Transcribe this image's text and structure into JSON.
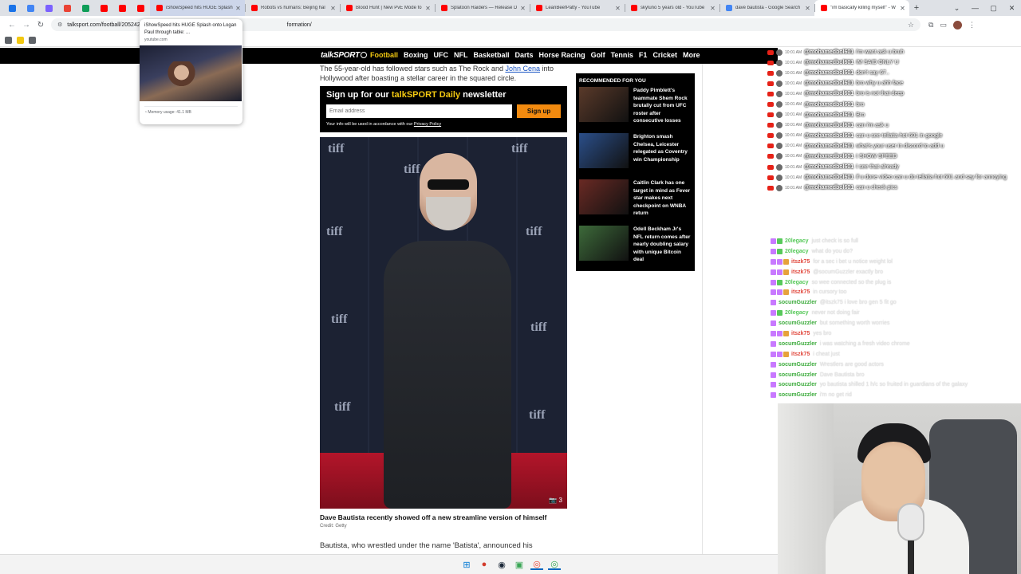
{
  "browser": {
    "pinned_colors": [
      "#1a73e8",
      "#4285f4",
      "#7b61ff",
      "#ea4335",
      "#0f9d58",
      "#ff0000",
      "#ff0000",
      "#ff0000"
    ],
    "tabs": [
      {
        "title": "iShowSpeed hits HUGE Splash",
        "fav": "#ff0000",
        "state": "hover"
      },
      {
        "title": "Robots vs humans: Beijing hal",
        "fav": "#ff0000",
        "state": ""
      },
      {
        "title": "Blood Hunt | New PvE Mode fo",
        "fav": "#ff0000",
        "state": ""
      },
      {
        "title": "Splatoon Raiders — Release D",
        "fav": "#ff0000",
        "state": ""
      },
      {
        "title": "LeanBeefPatty - YouTube",
        "fav": "#ff0000",
        "state": ""
      },
      {
        "title": "skyluno 5 years old - YouTube",
        "fav": "#ff0000",
        "state": ""
      },
      {
        "title": "dave bautista - Google Search",
        "fav": "#4285f4",
        "state": ""
      },
      {
        "title": "\"im basically killing myself\" - W",
        "fav": "#ff0000",
        "state": "active"
      }
    ],
    "new_tab": "+",
    "window_controls": [
      "▢",
      "—",
      "▢",
      "✕"
    ],
    "url_prefix": "talksport.com/football/2052421",
    "url_suffix": "formation/",
    "bookmark_colors": [
      "#5f6368",
      "#f2c811",
      "#5f6368"
    ]
  },
  "hovercard": {
    "title": "iShowSpeed hits HUGE Splash onto Logan Paul through table: ...",
    "site": "youtube.com",
    "memory": "Memory usage: 41.1 MB"
  },
  "site": {
    "logo": "talkSPORT",
    "nav": [
      "Football",
      "Boxing",
      "UFC",
      "NFL",
      "Basketball",
      "Darts",
      "Horse Racing",
      "Golf",
      "Tennis",
      "F1",
      "Cricket",
      "More"
    ],
    "intro_pre": "The 55-year-old has followed stars such as The Rock and ",
    "intro_link": "John Cena",
    "intro_post": "into Hollywood after boasting a stellar career in the squared circle.",
    "newsletter": {
      "head_pre": "Sign up for our ",
      "head_brand": "talkSPORT Daily",
      "head_post": " newsletter",
      "placeholder": "Email address",
      "button": "Sign up",
      "foot_pre": "Your info will be used in accordance with our ",
      "foot_link": "Privacy Policy"
    },
    "photo_count": "3",
    "caption": "Dave Bautista recently showed off a new streamline version of himself",
    "credit": "Credit: Getty",
    "body": "Bautista, who wrestled under the name 'Batista', announced his",
    "recommended_title": "RECOMMENDED FOR YOU",
    "recommended": [
      {
        "text": "Paddy Pimblett's teammate Shem Rock brutally cut from UFC roster after consecutive losses",
        "thumb": "#5a3a2a"
      },
      {
        "text": "Brighton smash Chelsea, Leicester relegated as Coventry win Championship",
        "thumb": "#2b4f8a"
      },
      {
        "text": "Caitlin Clark has one target in mind as Fever star makes next checkpoint on WNBA return",
        "thumb": "#6a2a24"
      },
      {
        "text": "Odell Beckham Jr's NFL return comes after nearly doubling salary with unique Bitcoin deal",
        "thumb": "#3d6a3a"
      }
    ]
  },
  "yt_chat": [
    {
      "time": "10:01 AM",
      "user": "@mohamedbol601",
      "msg": "i'm want ask u bruh"
    },
    {
      "time": "10:01 AM",
      "user": "@mohamedbol601",
      "msg": "IM SAID ONLY U"
    },
    {
      "time": "10:01 AM",
      "user": "@mohamedbol601",
      "msg": "don't say 67.."
    },
    {
      "time": "10:01 AM",
      "user": "@mohamedbol601",
      "msg": "bro why u ahh face"
    },
    {
      "time": "10:01 AM",
      "user": "@mohamedbol601",
      "msg": "bro is not that deep"
    },
    {
      "time": "10:01 AM",
      "user": "@mohamedbol601",
      "msg": "bro"
    },
    {
      "time": "10:01 AM",
      "user": "@mohamedbol601",
      "msg": "Bro"
    },
    {
      "time": "10:01 AM",
      "user": "@mohamedbol601",
      "msg": "can i'm ask u"
    },
    {
      "time": "10:01 AM",
      "user": "@mohamedbol601",
      "msg": "can u see tellatia hot 601 in google"
    },
    {
      "time": "10:01 AM",
      "user": "@mohamedbol601",
      "msg": "what's your user in discord to add u"
    },
    {
      "time": "10:01 AM",
      "user": "@mohamedbol601",
      "msg": "I SHOW SPEED"
    },
    {
      "time": "10:01 AM",
      "user": "@mohamedbol601",
      "msg": "I see that already"
    },
    {
      "time": "10:01 AM",
      "user": "@mohamedbol601",
      "msg": "if u done video can u do tellatia hot 601 and say for annoying"
    },
    {
      "time": "10:01 AM",
      "user": "@mohamedbol601",
      "msg": "can u check pics"
    }
  ],
  "tw_chat": [
    {
      "user": "20legacy",
      "color": "#57c95a",
      "msg": "just check is so full",
      "badges": [
        "#c879ff",
        "#57c95a"
      ]
    },
    {
      "user": "20legacy",
      "color": "#57c95a",
      "msg": "what do you do?",
      "badges": [
        "#c879ff",
        "#57c95a"
      ]
    },
    {
      "user": "itszk75",
      "color": "#e0453a",
      "msg": "for a sec i bet u notice weight lol",
      "badges": [
        "#c879ff",
        "#c879ff",
        "#e6a23c"
      ]
    },
    {
      "user": "itszk75",
      "color": "#e0453a",
      "msg": "@socumGuzzler exactly bro",
      "badges": [
        "#c879ff",
        "#c879ff",
        "#e6a23c"
      ]
    },
    {
      "user": "20legacy",
      "color": "#57c95a",
      "msg": "so wee connected so the plug is",
      "badges": [
        "#c879ff",
        "#57c95a"
      ]
    },
    {
      "user": "itszk75",
      "color": "#e0453a",
      "msg": "in cursory too",
      "badges": [
        "#c879ff",
        "#c879ff",
        "#e6a23c"
      ]
    },
    {
      "user": "socumGuzzler",
      "color": "#3cab3c",
      "msg": "@itszk75 i love bro gen 5 fit go",
      "badges": [
        "#c879ff"
      ]
    },
    {
      "user": "20legacy",
      "color": "#57c95a",
      "msg": "never not doing fair",
      "badges": [
        "#c879ff",
        "#57c95a"
      ]
    },
    {
      "user": "socumGuzzler",
      "color": "#3cab3c",
      "msg": "but something worth worries",
      "badges": [
        "#c879ff"
      ]
    },
    {
      "user": "itszk75",
      "color": "#e0453a",
      "msg": "yes bro",
      "badges": [
        "#c879ff",
        "#c879ff",
        "#e6a23c"
      ]
    },
    {
      "user": "socumGuzzler",
      "color": "#3cab3c",
      "msg": "i was watching a fresh video chrome",
      "badges": [
        "#c879ff"
      ]
    },
    {
      "user": "itszk75",
      "color": "#e0453a",
      "msg": "i cheat just",
      "badges": [
        "#c879ff",
        "#c879ff",
        "#e6a23c"
      ]
    },
    {
      "user": "socumGuzzler",
      "color": "#3cab3c",
      "msg": "Wrestlers are good actors",
      "badges": [
        "#c879ff"
      ]
    },
    {
      "user": "socumGuzzler",
      "color": "#3cab3c",
      "msg": "Dave Bautista bro",
      "badges": [
        "#c879ff"
      ]
    },
    {
      "user": "socumGuzzler",
      "color": "#3cab3c",
      "msg": "yo bautista shilled 1 h/c so fruited in guardians of the galaxy",
      "badges": [
        "#c879ff"
      ]
    },
    {
      "user": "socumGuzzler",
      "color": "#3cab3c",
      "msg": "i'm no get rid",
      "badges": [
        "#c879ff"
      ]
    }
  ],
  "taskbar": {
    "icons": [
      {
        "name": "windows-start-icon",
        "glyph": "⊞",
        "color": "#0078d4"
      },
      {
        "name": "record-app-icon",
        "glyph": "●",
        "color": "#d23c2c"
      },
      {
        "name": "steam-icon",
        "glyph": "◉",
        "color": "#1b2838"
      },
      {
        "name": "app-icon",
        "glyph": "▣",
        "color": "#3aa655"
      },
      {
        "name": "chrome-icon",
        "glyph": "◎",
        "color": "#ea4335"
      },
      {
        "name": "chrome-profile-icon",
        "glyph": "◎",
        "color": "#34a853"
      }
    ]
  }
}
